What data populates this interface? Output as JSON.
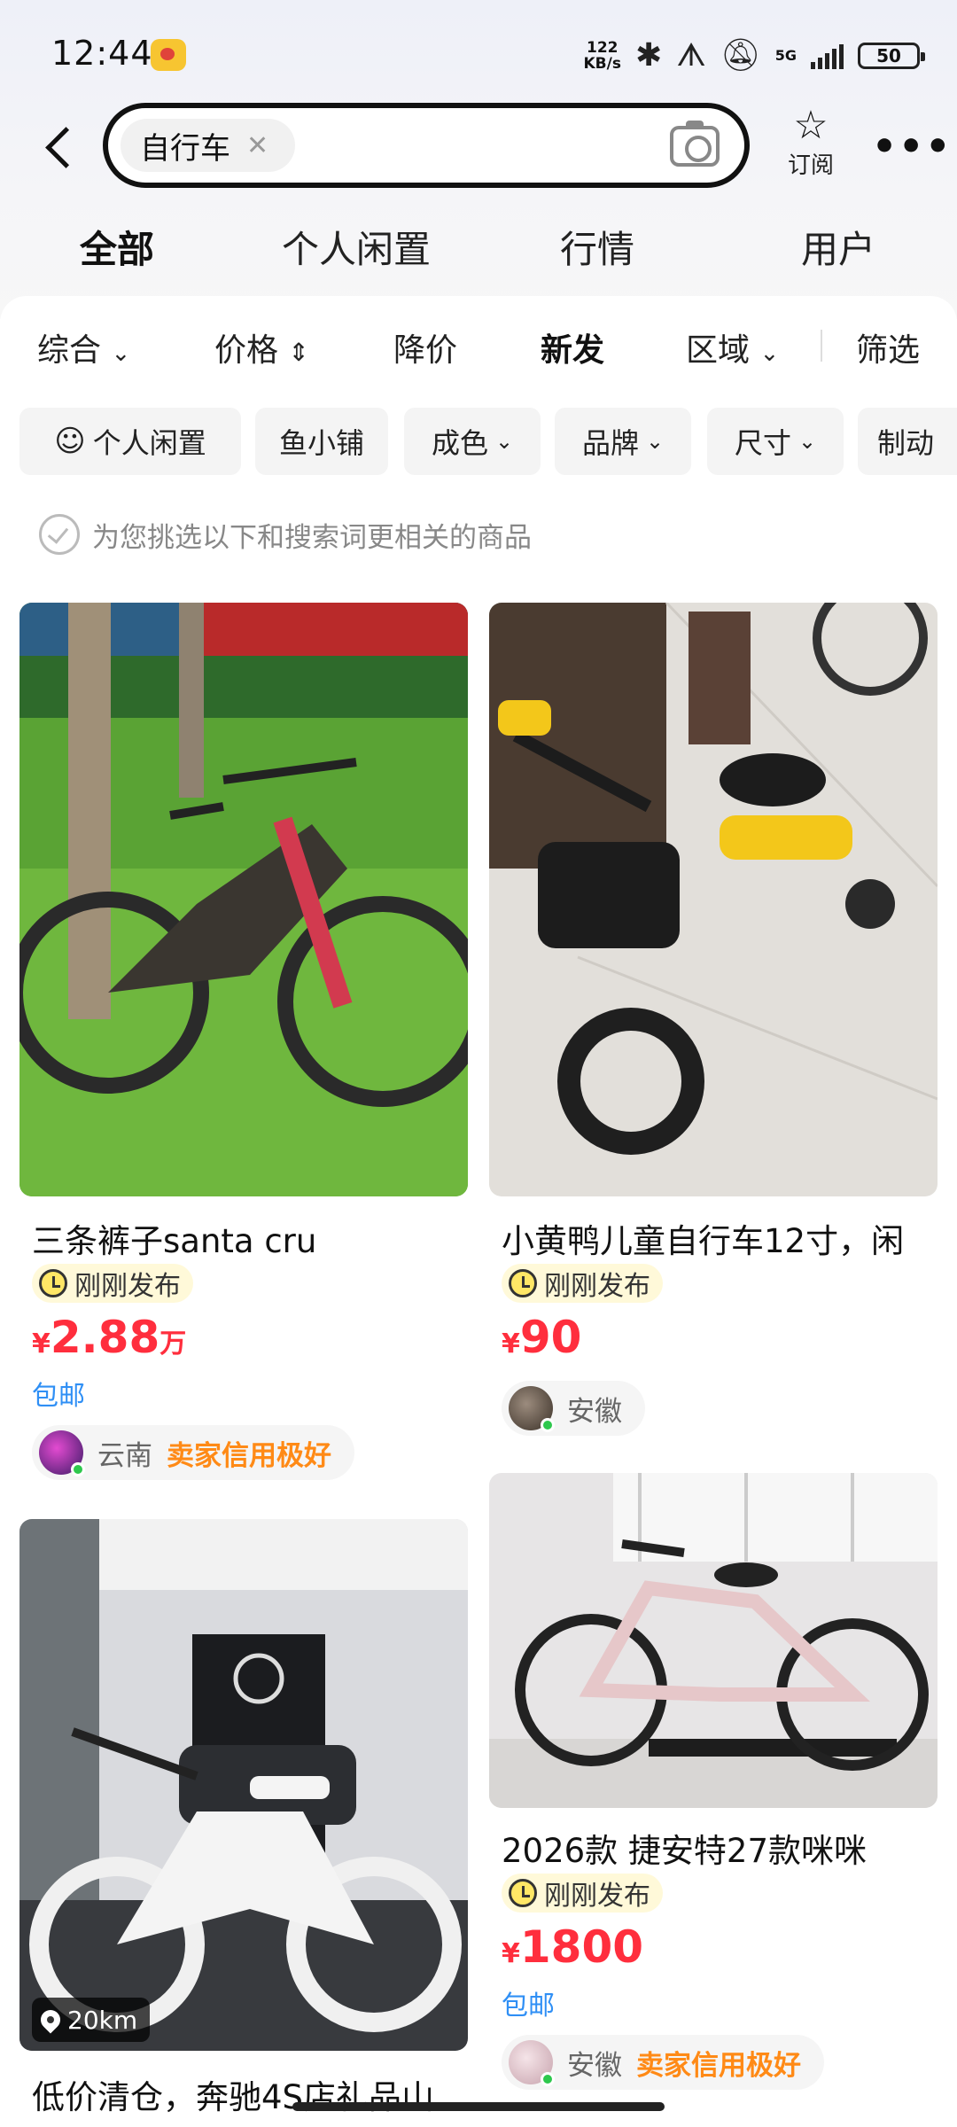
{
  "status_bar": {
    "time": "12:44",
    "speed_value": "122",
    "speed_unit": "KB/s",
    "network": "5G",
    "battery": "50"
  },
  "header": {
    "search_chip": "自行车",
    "subscribe_label": "订阅"
  },
  "tabs": [
    "全部",
    "个人闲置",
    "行情",
    "用户"
  ],
  "sort": {
    "general": "综合",
    "price": "价格",
    "price_drop": "降价",
    "newest": "新发",
    "region": "区域",
    "filter": "筛选"
  },
  "filters": [
    "个人闲置",
    "鱼小铺",
    "成色",
    "品牌",
    "尺寸",
    "制动"
  ],
  "hint": "为您挑选以下和搜索词更相关的商品",
  "items": [
    {
      "title": "三条裤子santa cru",
      "freshness": "刚刚发布",
      "currency": "¥",
      "price": "2.88",
      "price_unit": "万",
      "shipping": "包邮",
      "seller_region": "云南",
      "seller_credit": "卖家信用极好"
    },
    {
      "title": "小黄鸭儿童自行车12寸，闲",
      "freshness": "刚刚发布",
      "currency": "¥",
      "price": "90",
      "seller_region": "安徽"
    },
    {
      "title": "低价清仓，奔驰4S店礼品山",
      "distance": "20km"
    },
    {
      "title": "2026款 捷安特27款咪咪",
      "freshness": "刚刚发布",
      "currency": "¥",
      "price": "1800",
      "shipping": "包邮",
      "seller_region": "安徽",
      "seller_credit": "卖家信用极好"
    }
  ],
  "colors": {
    "accent_yellow": "#ffe11a",
    "price_red": "#ff2e3d",
    "shipping_blue": "#2f8ff5",
    "credit_orange": "#ff8a16"
  }
}
